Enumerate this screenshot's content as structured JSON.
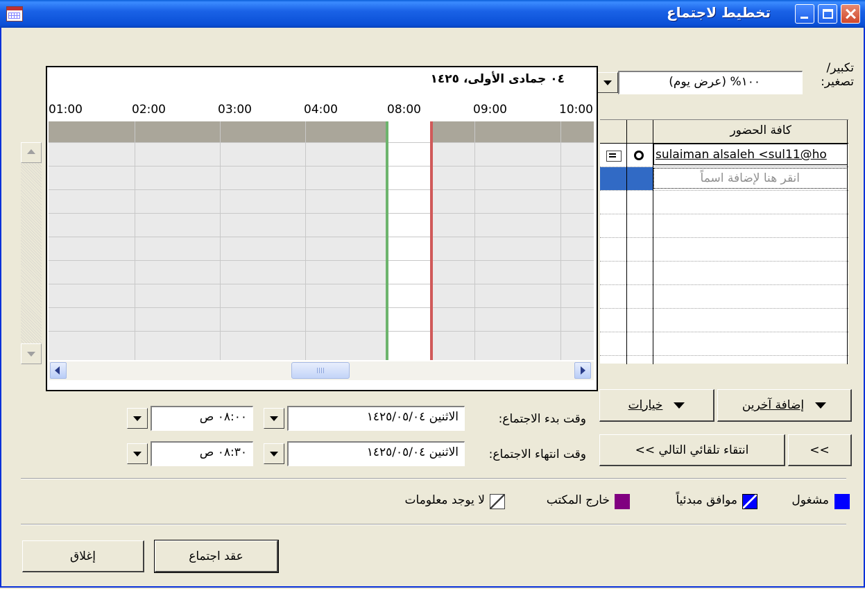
{
  "window": {
    "title": "تخطيط لاجتماع"
  },
  "zoom": {
    "label": "تكبير/ تصغير:",
    "value": "١٠٠% (عرض يوم)"
  },
  "schedule": {
    "date": "٠٤ جمادى الأولى، ١٤٢٥",
    "times": [
      "01:00",
      "02:00",
      "03:00",
      "04:00",
      "08:00",
      "09:00",
      "10:00"
    ]
  },
  "attendees": {
    "header": "كافة الحضور",
    "rows": [
      {
        "name": "sulaiman alsaleh <sul11@ho"
      }
    ],
    "add_placeholder": "انقر هنا لإضافة اسماً"
  },
  "buttons": {
    "add_others": "إضافة آخرين",
    "options": "خيارات",
    "autopick_next": "انتقاء تلقائي التالي >>",
    "prev": "<<",
    "make_meeting": "عقد اجتماع",
    "close": "إغلاق"
  },
  "meeting_start": {
    "label": "وقت بدء الاجتماع:",
    "date": "الاثنين ١٤٢٥/٠٥/٠٤",
    "time": "٠٨:٠٠ ص"
  },
  "meeting_end": {
    "label": "وقت انتهاء الاجتماع:",
    "date": "الاثنين ١٤٢٥/٠٥/٠٤",
    "time": "٠٨:٣٠ ص"
  },
  "legend": {
    "busy": "مشغول",
    "tentative": "موافق مبدئياً",
    "out_of_office": "خارج المكتب",
    "no_info": "لا يوجد معلومات"
  },
  "colors": {
    "titlebar": "#0a4fd6",
    "busy": "#0000ff",
    "tentative": "#0000ff",
    "out_of_office": "#800080",
    "start_line": "#6db46d",
    "end_line": "#d05a5a"
  }
}
